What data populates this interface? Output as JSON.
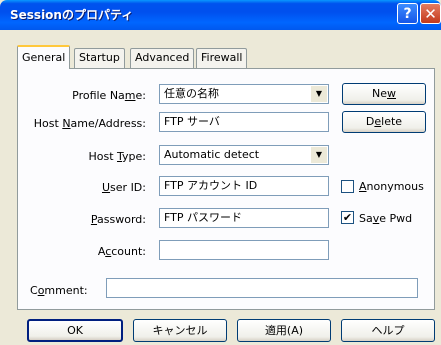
{
  "window": {
    "title": "Sessionのプロパティ",
    "help_glyph": "?",
    "close_glyph": "✕"
  },
  "tabs": [
    {
      "label": "General",
      "active": true
    },
    {
      "label": "Startup",
      "active": false
    },
    {
      "label": "Advanced",
      "active": false
    },
    {
      "label": "Firewall",
      "active": false
    }
  ],
  "form": {
    "profile_name": {
      "label_pre": "Profile Na",
      "label_u": "m",
      "label_post": "e:",
      "value": "任意の名称"
    },
    "host_name": {
      "label_pre": "Host ",
      "label_u": "N",
      "label_post": "ame/Address:",
      "value": "FTP サーバ"
    },
    "host_type": {
      "label_pre": "Host ",
      "label_u": "T",
      "label_post": "ype:",
      "value": "Automatic detect"
    },
    "user_id": {
      "label_pre": "",
      "label_u": "U",
      "label_post": "ser ID:",
      "value": "FTP アカウント ID"
    },
    "password": {
      "label_pre": "",
      "label_u": "P",
      "label_post": "assword:",
      "value": "FTP パスワード"
    },
    "account": {
      "label_pre": "A",
      "label_u": "c",
      "label_post": "count:",
      "value": ""
    },
    "comment": {
      "label_pre": "C",
      "label_u": "o",
      "label_post": "mment:",
      "value": ""
    }
  },
  "side_buttons": {
    "new": {
      "pre": "Ne",
      "u": "w",
      "post": ""
    },
    "delete": {
      "pre": "D",
      "u": "e",
      "post": "lete"
    }
  },
  "checkboxes": {
    "anonymous": {
      "pre": "",
      "u": "A",
      "post": "nonymous",
      "checked": false
    },
    "save_pwd": {
      "pre": "Sa",
      "u": "v",
      "post": "e Pwd",
      "checked": true
    }
  },
  "footer": {
    "ok": "OK",
    "cancel": "キャンセル",
    "apply": "適用(A)",
    "help": "ヘルプ"
  }
}
